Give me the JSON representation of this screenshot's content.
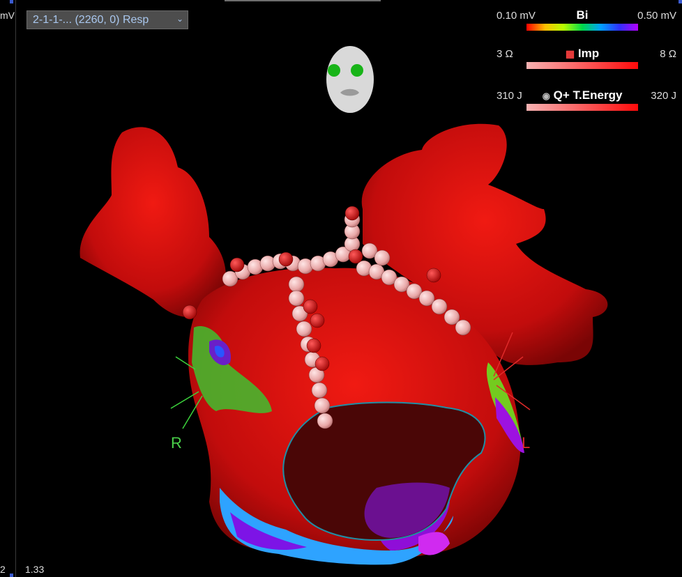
{
  "left_panel": {
    "unit": "mV",
    "value": "2"
  },
  "map_selector": {
    "value": "2-1-1-... (2260, 0) Resp"
  },
  "legends": [
    {
      "min": "0.10 mV",
      "title": "Bi",
      "max": "0.50 mV",
      "icon": "none",
      "gradient": "rainbow"
    },
    {
      "min": "3 Ω",
      "title": "Imp",
      "max": "8 Ω",
      "icon": "grid-ball-icon",
      "gradient": "pink-red"
    },
    {
      "min": "310 J",
      "title": "Q+ T.Energy",
      "max": "320 J",
      "icon": "dot-ball-icon",
      "gradient": "pink-red"
    }
  ],
  "zoom": "1.33",
  "orientation": {
    "right_label": "R",
    "left_label": "L"
  }
}
